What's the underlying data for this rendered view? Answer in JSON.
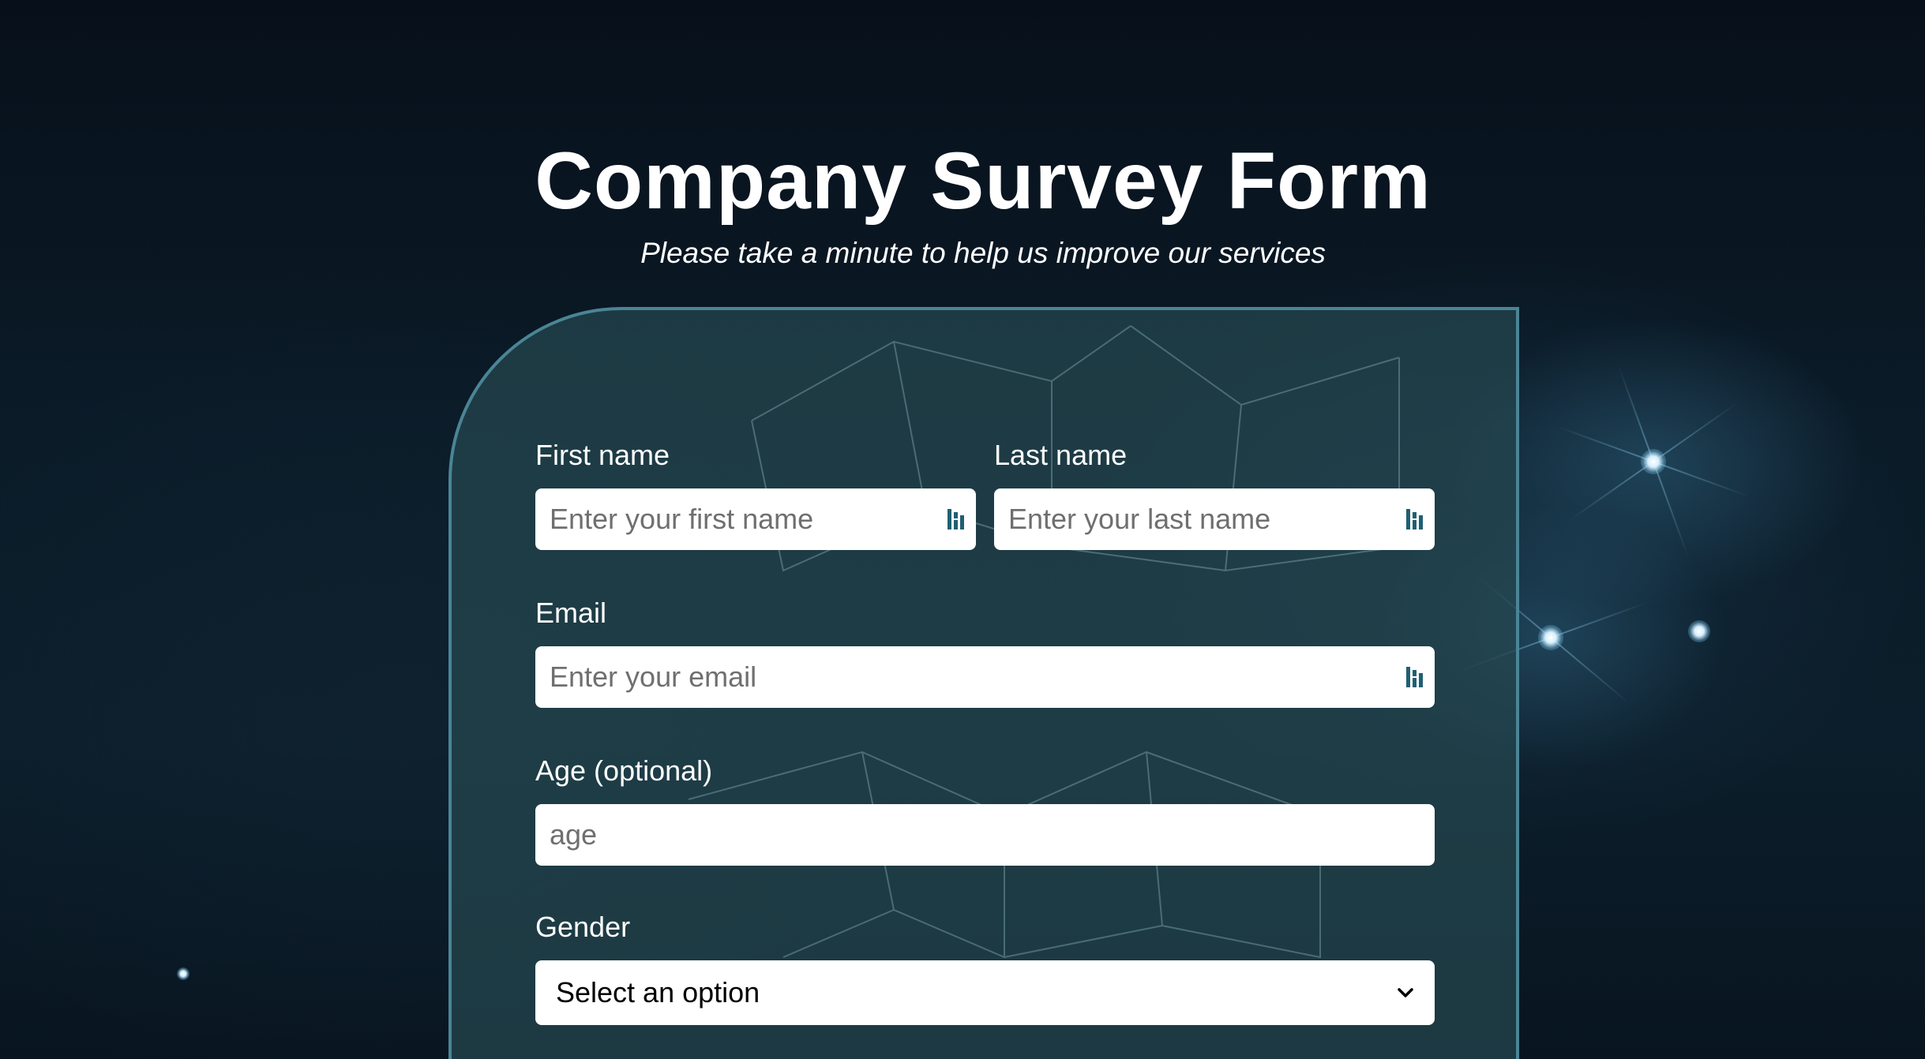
{
  "header": {
    "title": "Company Survey Form",
    "subtitle": "Please take a minute to help us improve our services"
  },
  "form": {
    "first_name": {
      "label": "First name",
      "placeholder": "Enter your first name",
      "value": ""
    },
    "last_name": {
      "label": "Last name",
      "placeholder": "Enter your last name",
      "value": ""
    },
    "email": {
      "label": "Email",
      "placeholder": "Enter your email",
      "value": ""
    },
    "age": {
      "label": "Age (optional)",
      "placeholder": "age",
      "value": ""
    },
    "gender": {
      "label": "Gender",
      "selected": "Select an option"
    }
  },
  "icons": {
    "input_autofill": "password-manager-icon",
    "select_arrow": "chevron-down-icon"
  },
  "colors": {
    "card_border": "#4a8596",
    "icon_teal": "#1f5f73",
    "text": "#ffffff"
  }
}
